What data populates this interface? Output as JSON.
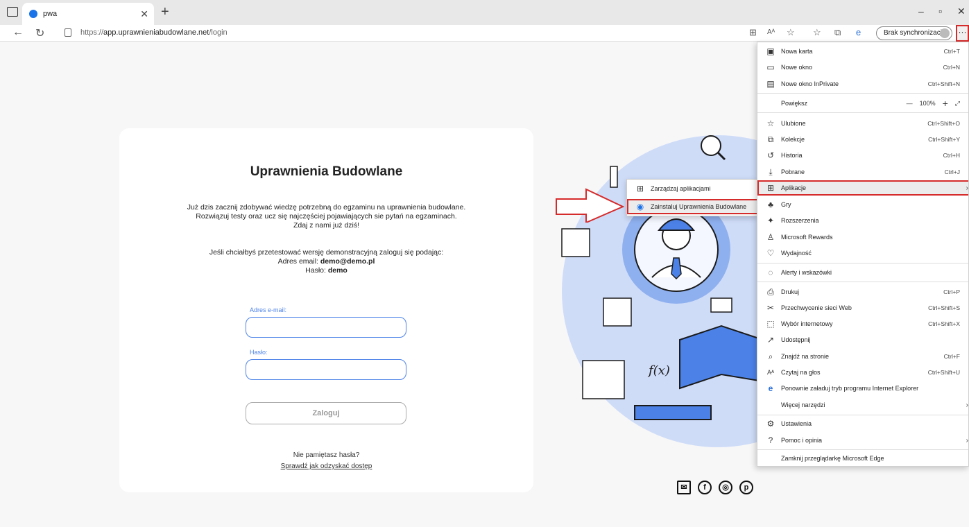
{
  "browser": {
    "tab_title": "pwa",
    "url_prefix": "https://",
    "url_domain": "app.uprawnieniabudowlane.net",
    "url_path": "/login",
    "sync_label": "Brak synchronizacji",
    "more_label": "···"
  },
  "login": {
    "title": "Uprawnienia Budowlane",
    "intro_1": "Już dzis zacznij zdobywać wiedzę potrzebną do egzaminu na uprawnienia budowlane.",
    "intro_2": "Rozwiązuj testy oraz ucz się najczęściej pojawiających sie pytań na egzaminach.",
    "intro_3": "Zdaj z nami już dziś!",
    "demo_1": "Jeśli chciałbyś przetestować wersję demonstracyjną zaloguj się podając:",
    "demo_email_label": "Adres email: ",
    "demo_email": "demo@demo.pl",
    "demo_password_label": "Hasło: ",
    "demo_password": "demo",
    "email_label": "Adres e-mail:",
    "password_label": "Hasło:",
    "submit_label": "Zaloguj",
    "forgot_text": "Nie pamiętasz hasła?",
    "recover_link": "Sprawdź jak odzyskać dostęp"
  },
  "menu": {
    "items": [
      {
        "label": "Nowa karta",
        "shortcut": "Ctrl+T",
        "icon": "new-tab-icon"
      },
      {
        "label": "Nowe okno",
        "shortcut": "Ctrl+N",
        "icon": "new-window-icon"
      },
      {
        "label": "Nowe okno InPrivate",
        "shortcut": "Ctrl+Shift+N",
        "icon": "inprivate-icon"
      },
      {
        "label": "Powiększ",
        "shortcut": "",
        "icon": ""
      },
      {
        "label": "Ulubione",
        "shortcut": "Ctrl+Shift+O",
        "icon": "favorites-icon"
      },
      {
        "label": "Kolekcje",
        "shortcut": "Ctrl+Shift+Y",
        "icon": "collections-icon"
      },
      {
        "label": "Historia",
        "shortcut": "Ctrl+H",
        "icon": "history-icon"
      },
      {
        "label": "Pobrane",
        "shortcut": "Ctrl+J",
        "icon": "downloads-icon"
      },
      {
        "label": "Aplikacje",
        "shortcut": "",
        "icon": "apps-icon"
      },
      {
        "label": "Gry",
        "shortcut": "",
        "icon": "games-icon"
      },
      {
        "label": "Rozszerzenia",
        "shortcut": "",
        "icon": "extensions-icon"
      },
      {
        "label": "Microsoft Rewards",
        "shortcut": "",
        "icon": "rewards-icon"
      },
      {
        "label": "Wydajność",
        "shortcut": "",
        "icon": "performance-icon"
      },
      {
        "label": "Alerty i wskazówki",
        "shortcut": "",
        "icon": "alerts-icon"
      },
      {
        "label": "Drukuj",
        "shortcut": "Ctrl+P",
        "icon": "print-icon"
      },
      {
        "label": "Przechwycenie sieci Web",
        "shortcut": "Ctrl+Shift+S",
        "icon": "web-capture-icon"
      },
      {
        "label": "Wybór internetowy",
        "shortcut": "Ctrl+Shift+X",
        "icon": "web-select-icon"
      },
      {
        "label": "Udostępnij",
        "shortcut": "",
        "icon": "share-icon"
      },
      {
        "label": "Znajdź na stronie",
        "shortcut": "Ctrl+F",
        "icon": "find-icon"
      },
      {
        "label": "Czytaj na głos",
        "shortcut": "Ctrl+Shift+U",
        "icon": "read-aloud-icon"
      },
      {
        "label": "Ponownie załaduj tryb programu Internet Explorer",
        "shortcut": "",
        "icon": "ie-icon"
      },
      {
        "label": "Więcej narzędzi",
        "shortcut": "",
        "icon": ""
      },
      {
        "label": "Ustawienia",
        "shortcut": "",
        "icon": "settings-icon"
      },
      {
        "label": "Pomoc i opinia",
        "shortcut": "",
        "icon": "help-icon"
      },
      {
        "label": "Zamknij przeglądarkę Microsoft Edge",
        "shortcut": "",
        "icon": ""
      }
    ],
    "zoom_value": "100%"
  },
  "submenu": {
    "manage_label": "Zarządzaj aplikacjami",
    "install_label": "Zainstaluj Uprawnienia Budowlane"
  },
  "colors": {
    "accent": "#4c82e8",
    "highlight_border": "#d62b2b",
    "illustration_blue": "#cfdcf8"
  }
}
